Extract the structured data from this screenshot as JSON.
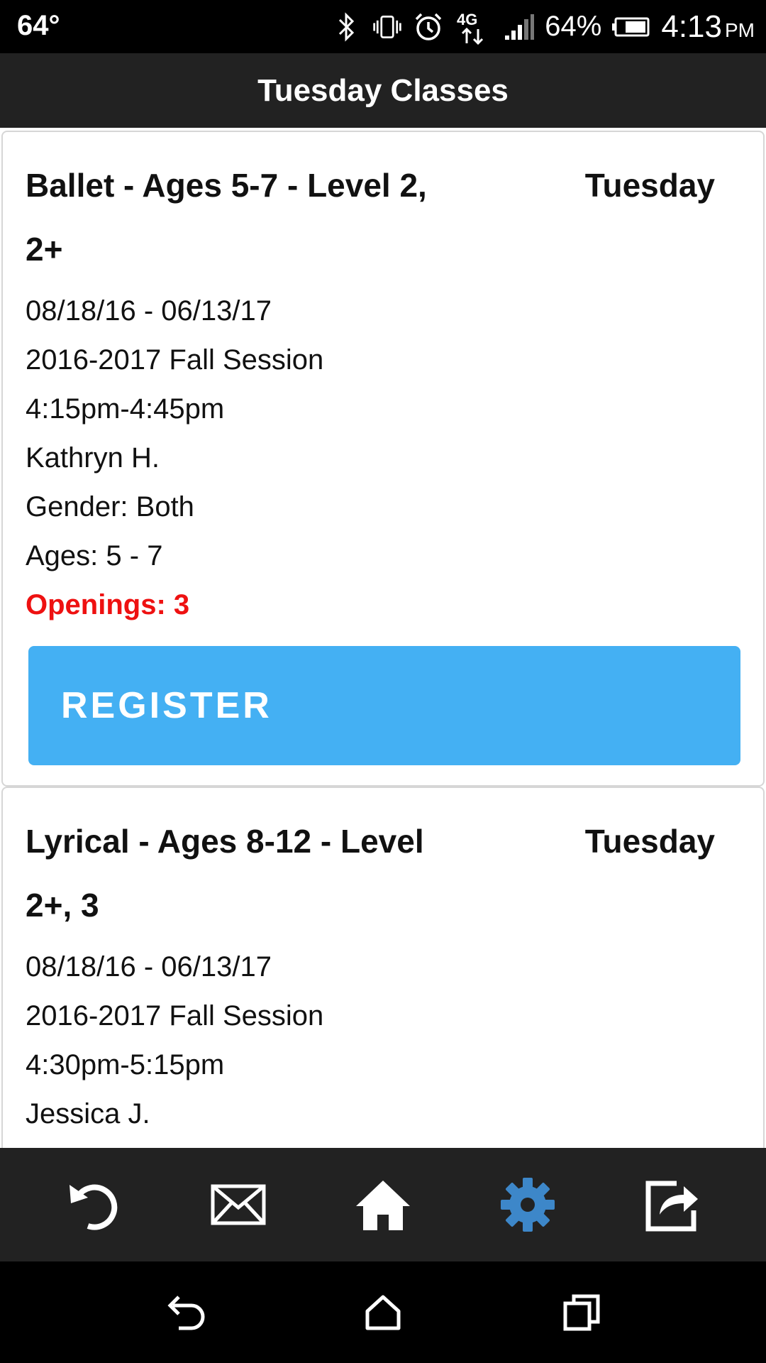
{
  "status_bar": {
    "temperature": "64°",
    "network": "4G",
    "battery_percent": "64%",
    "time": "4:13",
    "ampm": "PM",
    "icons": [
      "bluetooth-icon",
      "vibrate-icon",
      "alarm-icon",
      "4g-lte-icon",
      "signal-icon",
      "battery-icon"
    ]
  },
  "header": {
    "title": "Tuesday Classes"
  },
  "classes": [
    {
      "name": "Ballet - Ages 5-7 - Level 2, 2+",
      "day": "Tuesday",
      "dates": "08/18/16 - 06/13/17",
      "session": "2016-2017 Fall Session",
      "time": "4:15pm-4:45pm",
      "instructor": "Kathryn H.",
      "gender": "Gender: Both",
      "ages": "Ages: 5 - 7",
      "openings": "Openings: 3",
      "register_label": "REGISTER"
    },
    {
      "name": "Lyrical - Ages 8-12 - Level 2+, 3",
      "day": "Tuesday",
      "dates": "08/18/16 - 06/13/17",
      "session": "2016-2017 Fall Session",
      "time": "4:30pm-5:15pm",
      "instructor": "Jessica J."
    }
  ],
  "toolbar": {
    "items": [
      "refresh-icon",
      "mail-icon",
      "home-icon",
      "settings-icon",
      "share-icon"
    ],
    "active_color": "#3d87c9",
    "icon_color": "#ffffff"
  },
  "navbar": {
    "items": [
      "back-icon",
      "home-icon",
      "recents-icon"
    ]
  },
  "colors": {
    "header_bg": "#222222",
    "register_bg": "#44b0f3",
    "openings_text": "#ee1111"
  }
}
